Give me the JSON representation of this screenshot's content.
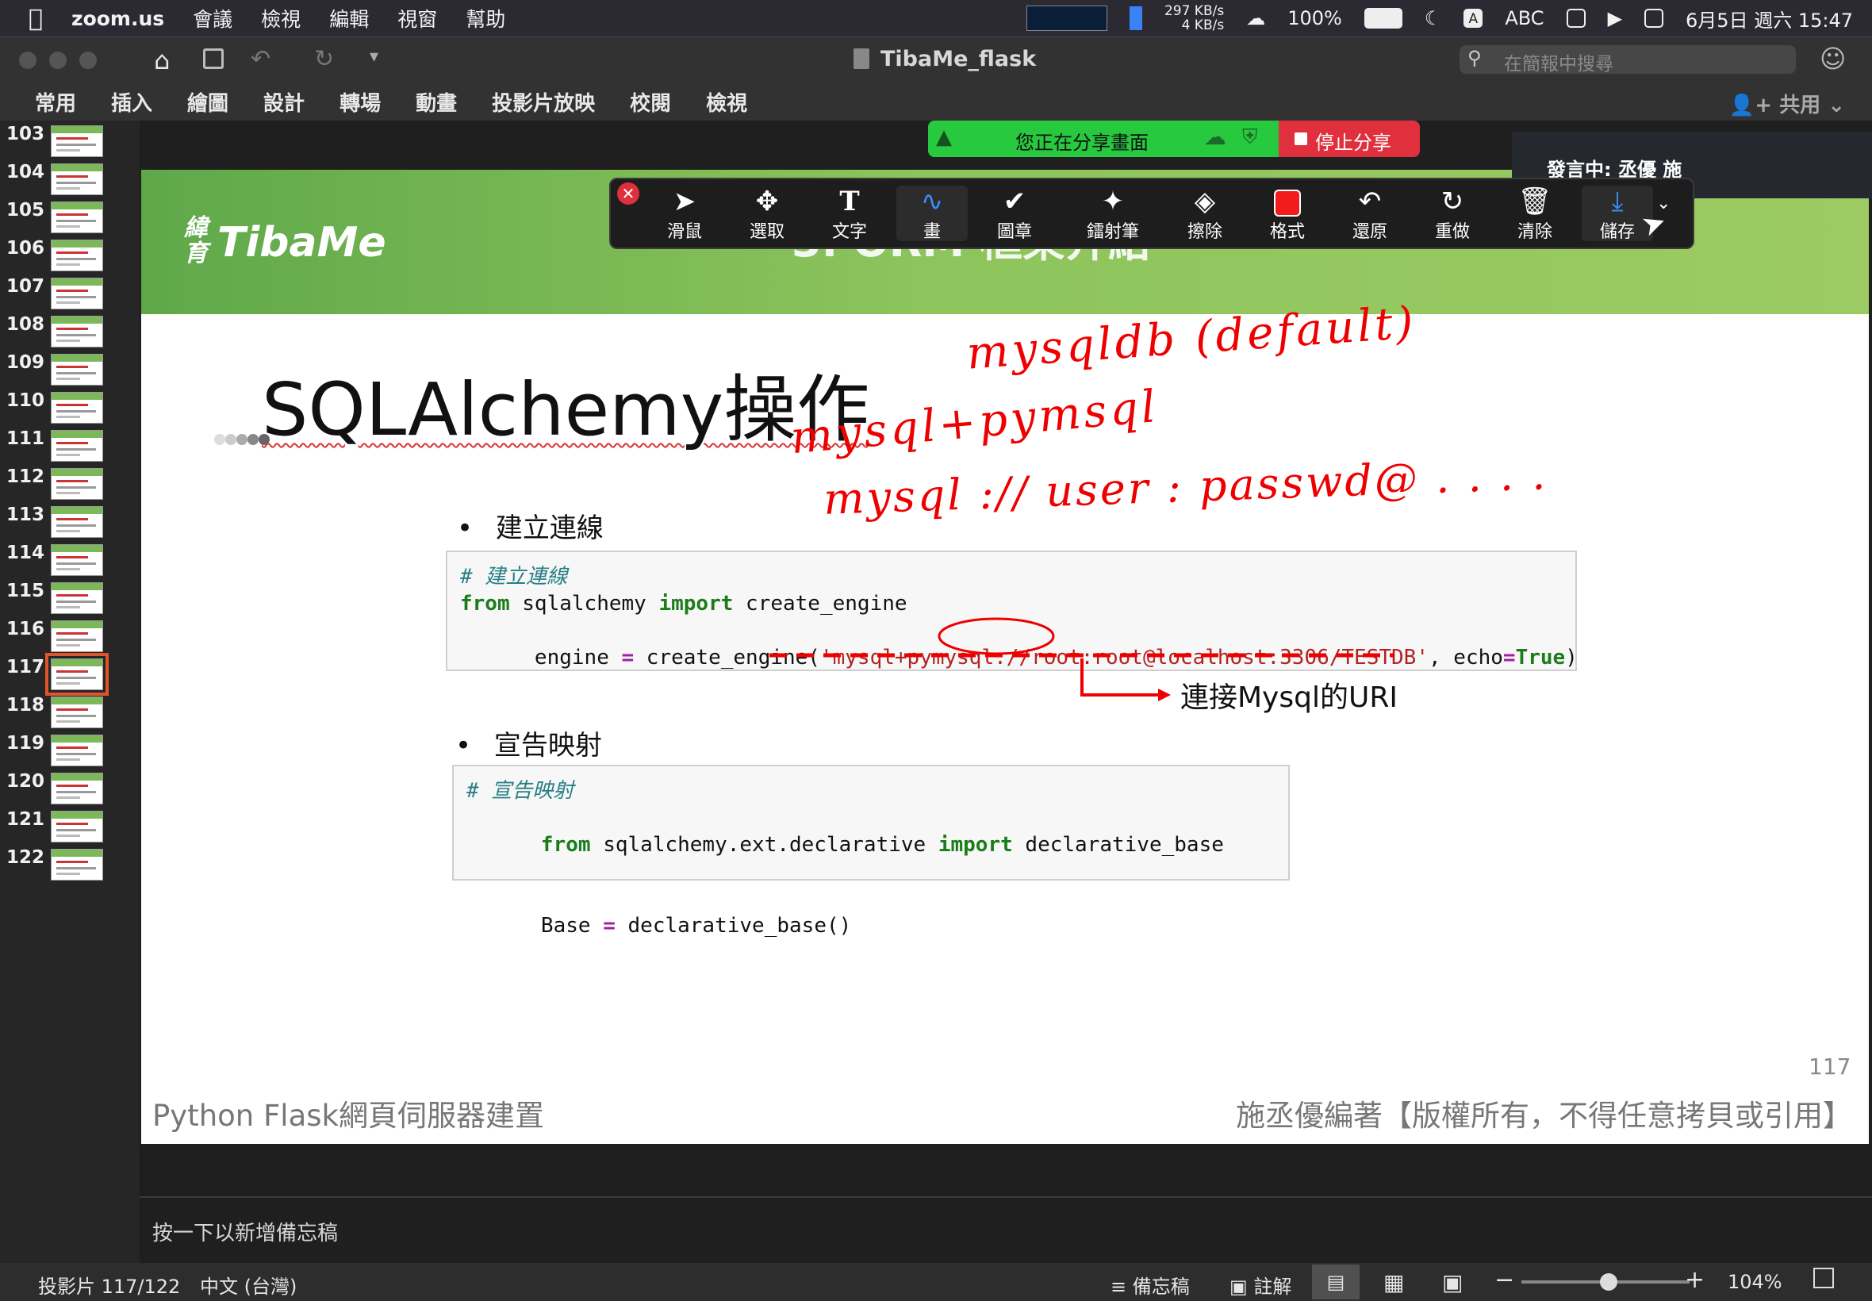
{
  "menubar": {
    "app_name": "zoom.us",
    "menus": [
      "會議",
      "檢視",
      "編輯",
      "視窗",
      "幫助"
    ],
    "net_up": "297 KB/s",
    "net_down": "4 KB/s",
    "battery": "100%",
    "input_method": "ABC",
    "datetime": "6月5日 週六 15:47"
  },
  "window": {
    "title": "TibaMe_flask",
    "search_placeholder": "在簡報中搜尋",
    "share_label": "共用"
  },
  "ribbon": {
    "tabs": [
      "常用",
      "插入",
      "繪圖",
      "設計",
      "轉場",
      "動畫",
      "投影片放映",
      "校閱",
      "檢視"
    ]
  },
  "thumbnails": {
    "items": [
      {
        "num": "103"
      },
      {
        "num": "104"
      },
      {
        "num": "105"
      },
      {
        "num": "106"
      },
      {
        "num": "107"
      },
      {
        "num": "108"
      },
      {
        "num": "109"
      },
      {
        "num": "110"
      },
      {
        "num": "111"
      },
      {
        "num": "112"
      },
      {
        "num": "113"
      },
      {
        "num": "114"
      },
      {
        "num": "115"
      },
      {
        "num": "116"
      },
      {
        "num": "117"
      },
      {
        "num": "118"
      },
      {
        "num": "119"
      },
      {
        "num": "120"
      },
      {
        "num": "121"
      },
      {
        "num": "122"
      }
    ],
    "selected": "117"
  },
  "zoom": {
    "sharing_text": "您正在分享畫面",
    "stop_share": "停止分享",
    "speaker": "發言中: 丞優 施",
    "toolbar": [
      "滑鼠",
      "選取",
      "文字",
      "畫",
      "圖章",
      "鐳射筆",
      "擦除",
      "格式",
      "還原",
      "重做",
      "清除",
      "儲存"
    ]
  },
  "slide": {
    "logo_cn": "緯育",
    "logo": "TibaMe",
    "header_partial": "3. ORM 框架介紹",
    "title": "SQLAlchemy操作",
    "bullet1": "建立連線",
    "code1": {
      "comment": "# 建立連線",
      "line2_from": "from",
      "line2_mod": " sqlalchemy ",
      "line2_import": "import",
      "line2_name": " create_engine",
      "line3_pre": "engine ",
      "line3_eq": "=",
      "line3_call": " create_engine(",
      "line3_str": "'mysql+pymysql://root:root@localhost:3306/TESTDB'",
      "line3_mid": ", echo",
      "line3_eq2": "=",
      "line3_true": "True",
      "line3_end": ")"
    },
    "uri_note": "連接Mysql的URI",
    "bullet2": "宣告映射",
    "code2": {
      "comment": "# 宣告映射",
      "line2_from": "from",
      "line2_mod": " sqlalchemy.ext.declarative ",
      "line2_import": "import",
      "line2_name": " declarative_base",
      "line3_pre": "Base ",
      "line3_eq": "=",
      "line3_call": " declarative_base()"
    },
    "handwriting": {
      "line1": "mysqldb (default)",
      "line2": "mysql+pymsql",
      "line3": "mysql :// user : passwd@ . . . ."
    },
    "page_number": "117",
    "footer_left": "Python Flask網頁伺服器建置",
    "footer_right": "施丞優編著【版權所有，不得任意拷貝或引用】"
  },
  "notes": {
    "placeholder": "按一下以新增備忘稿"
  },
  "status": {
    "slide_pos": "投影片 117/122",
    "language": "中文 (台灣)",
    "notes_btn": "備忘稿",
    "comments_btn": "註解",
    "zoom_level": "104%",
    "zoom_fraction": 0.52
  }
}
